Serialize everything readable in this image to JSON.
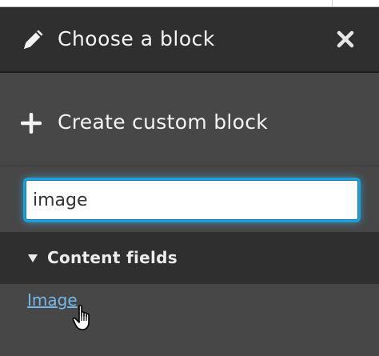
{
  "dialog": {
    "title": "Choose a block",
    "title_icon": "pencil-icon",
    "close_icon": "close-icon"
  },
  "create_block": {
    "label": "Create custom block",
    "icon": "plus-icon"
  },
  "search": {
    "value": "image"
  },
  "section": {
    "label": "Content fields",
    "expanded": true,
    "icon": "caret-down-icon"
  },
  "results": [
    {
      "label": "Image"
    }
  ],
  "colors": {
    "header_bg": "#2f2f2f",
    "panel_bg": "#474747",
    "focus_ring": "#1e9fd8",
    "link": "#76b8e8",
    "text": "#f4f4f4"
  }
}
